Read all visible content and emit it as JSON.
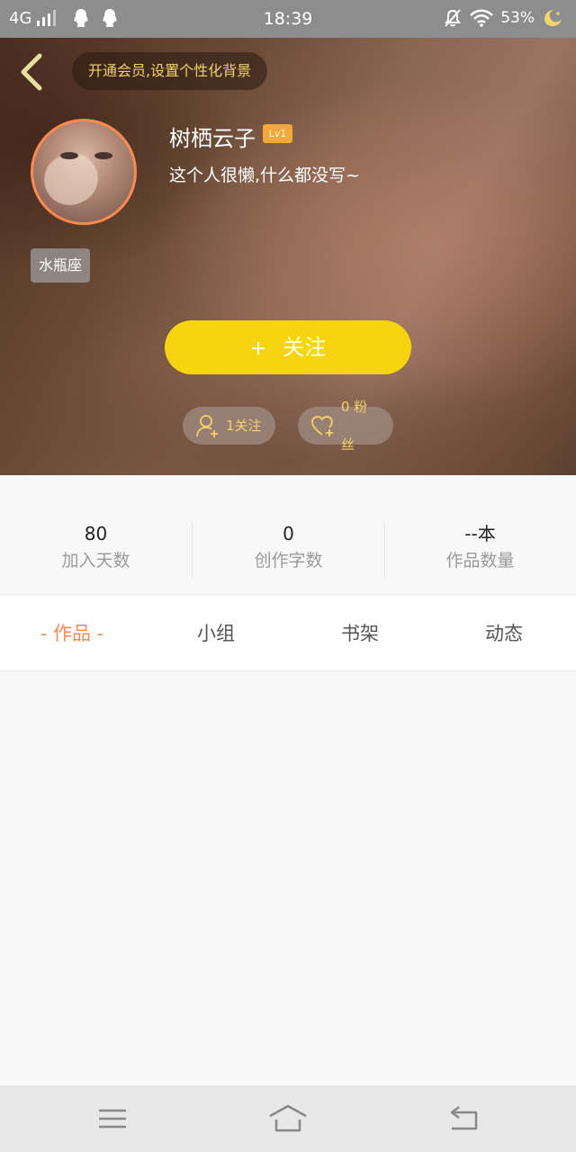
{
  "status_bar": {
    "network": "4G",
    "time": "18:39",
    "battery": "53%",
    "icons": [
      "signal-icon",
      "qq-icon",
      "qq-icon",
      "silent-bell-icon",
      "wifi-icon",
      "moon-icon"
    ]
  },
  "header": {
    "vip_prompt": "开通会员,设置个性化背景",
    "username": "树栖云子",
    "level": "Lv1",
    "bio": "这个人很懒,什么都没写~",
    "zodiac": "水瓶座",
    "follow_label": "关注",
    "follow_plus": "+",
    "following": "1关注",
    "fans": "0 粉丝"
  },
  "stats": [
    {
      "value": "80",
      "label": "加入天数"
    },
    {
      "value": "0",
      "label": "创作字数"
    },
    {
      "value": "--本",
      "label": "作品数量"
    }
  ],
  "tabs": [
    {
      "label": "- 作品 -",
      "active": true
    },
    {
      "label": "小组",
      "active": false
    },
    {
      "label": "书架",
      "active": false
    },
    {
      "label": "动态",
      "active": false
    }
  ],
  "colors": {
    "accent": "#ff8a50",
    "follow_button": "#f6d40f",
    "gold_text": "#f3d36a",
    "level_badge": "#f0a93a"
  },
  "nav_icons": [
    "menu-icon",
    "home-icon",
    "back-nav-icon"
  ]
}
